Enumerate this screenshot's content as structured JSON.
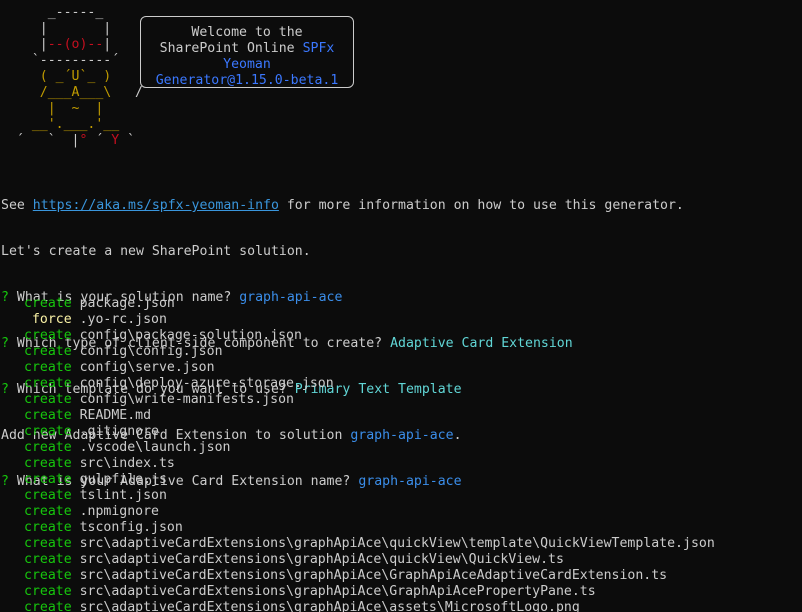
{
  "greeting": {
    "line1": "Welcome to the",
    "line2": "SharePoint Online",
    "spfx": "SPFx",
    "line3": "Yeoman",
    "line4": "Generator@1.15.0-beta.1"
  },
  "info": {
    "see": "See ",
    "url": "https://aka.ms/spfx-yeoman-info",
    "suffix": " for more information on how to use this generator.",
    "create_line": "Let's create a new SharePoint solution."
  },
  "prompts": [
    {
      "q": "What is your solution name? ",
      "a": "graph-api-ace"
    },
    {
      "q": "Which type of client-side component to create? ",
      "a": "Adaptive Card Extension"
    },
    {
      "q": "Which template do you want to use? ",
      "a": "Primary Text Template"
    }
  ],
  "add_line": {
    "prefix": "Add new Adaptive Card Extension to solution ",
    "name": "graph-api-ace",
    "suffix": "."
  },
  "last_prompt": {
    "q": "What is your Adaptive Card Extension name? ",
    "a": "graph-api-ace"
  },
  "files": [
    {
      "action": "create",
      "path": "package.json"
    },
    {
      "action": " force",
      "path": ".yo-rc.json"
    },
    {
      "action": "create",
      "path": "config\\package-solution.json"
    },
    {
      "action": "create",
      "path": "config\\config.json"
    },
    {
      "action": "create",
      "path": "config\\serve.json"
    },
    {
      "action": "create",
      "path": "config\\deploy-azure-storage.json"
    },
    {
      "action": "create",
      "path": "config\\write-manifests.json"
    },
    {
      "action": "create",
      "path": "README.md"
    },
    {
      "action": "create",
      "path": ".gitignore"
    },
    {
      "action": "create",
      "path": ".vscode\\launch.json"
    },
    {
      "action": "create",
      "path": "src\\index.ts"
    },
    {
      "action": "create",
      "path": "gulpfile.js"
    },
    {
      "action": "create",
      "path": "tslint.json"
    },
    {
      "action": "create",
      "path": ".npmignore"
    },
    {
      "action": "create",
      "path": "tsconfig.json"
    },
    {
      "action": "create",
      "path": "src\\adaptiveCardExtensions\\graphApiAce\\quickView\\template\\QuickViewTemplate.json"
    },
    {
      "action": "create",
      "path": "src\\adaptiveCardExtensions\\graphApiAce\\quickView\\QuickView.ts"
    },
    {
      "action": "create",
      "path": "src\\adaptiveCardExtensions\\graphApiAce\\GraphApiAceAdaptiveCardExtension.ts"
    },
    {
      "action": "create",
      "path": "src\\adaptiveCardExtensions\\graphApiAce\\GraphApiAcePropertyPane.ts"
    },
    {
      "action": "create",
      "path": "src\\adaptiveCardExtensions\\graphApiAce\\assets\\MicrosoftLogo.png"
    }
  ],
  "colors": {
    "background": "#0c0c0c",
    "text": "#cccccc",
    "prompt_mark": "#16c60c",
    "answer": "#61d6d6",
    "create": "#16c60c",
    "force": "#f9f1a5",
    "spfx": "#3b78ff"
  }
}
